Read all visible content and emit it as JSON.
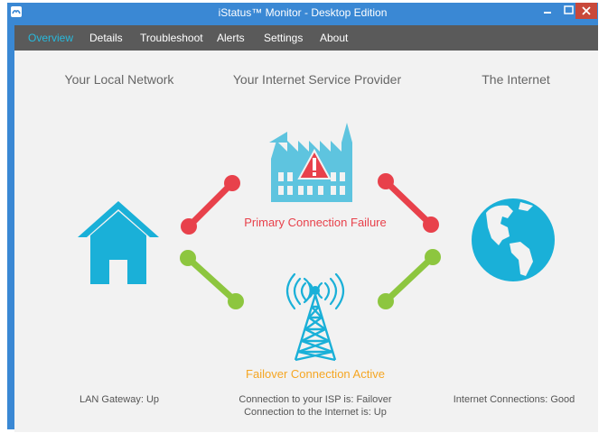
{
  "window": {
    "title": "iStatus™ Monitor - Desktop Edition"
  },
  "menu": {
    "tabs": [
      {
        "label": "Overview",
        "active": true
      },
      {
        "label": "Details",
        "active": false
      },
      {
        "label": "Troubleshoot",
        "active": false
      },
      {
        "label": "Alerts",
        "active": false
      },
      {
        "label": "Settings",
        "active": false
      },
      {
        "label": "About",
        "active": false
      }
    ]
  },
  "overview": {
    "headers": {
      "local": "Your Local Network",
      "isp": "Your Internet Service Provider",
      "internet": "The Internet"
    },
    "primary_message": "Primary Connection Failure",
    "failover_message": "Failover Connection Active",
    "status": {
      "lan": "LAN Gateway: Up",
      "isp_line1": "Connection to your ISP is: Failover",
      "isp_line2": "Connection to the Internet is: Up",
      "internet": "Internet Connections: Good"
    },
    "icons": {
      "local": "home-icon",
      "isp": "factory-warning-icon",
      "failover": "radio-tower-icon",
      "internet": "globe-icon",
      "primary_links": "red-link-icon",
      "failover_links": "green-link-icon"
    }
  },
  "colors": {
    "window_border": "#3a88d4",
    "menubar": "#5a5a5a",
    "active_tab": "#28b9dc",
    "content_bg": "#f2f2f2",
    "icon_blue": "#1ab0d8",
    "failure_red": "#e8414b",
    "success_green": "#8dc63f",
    "failover_orange": "#f5a623",
    "close_button": "#c9483a"
  }
}
